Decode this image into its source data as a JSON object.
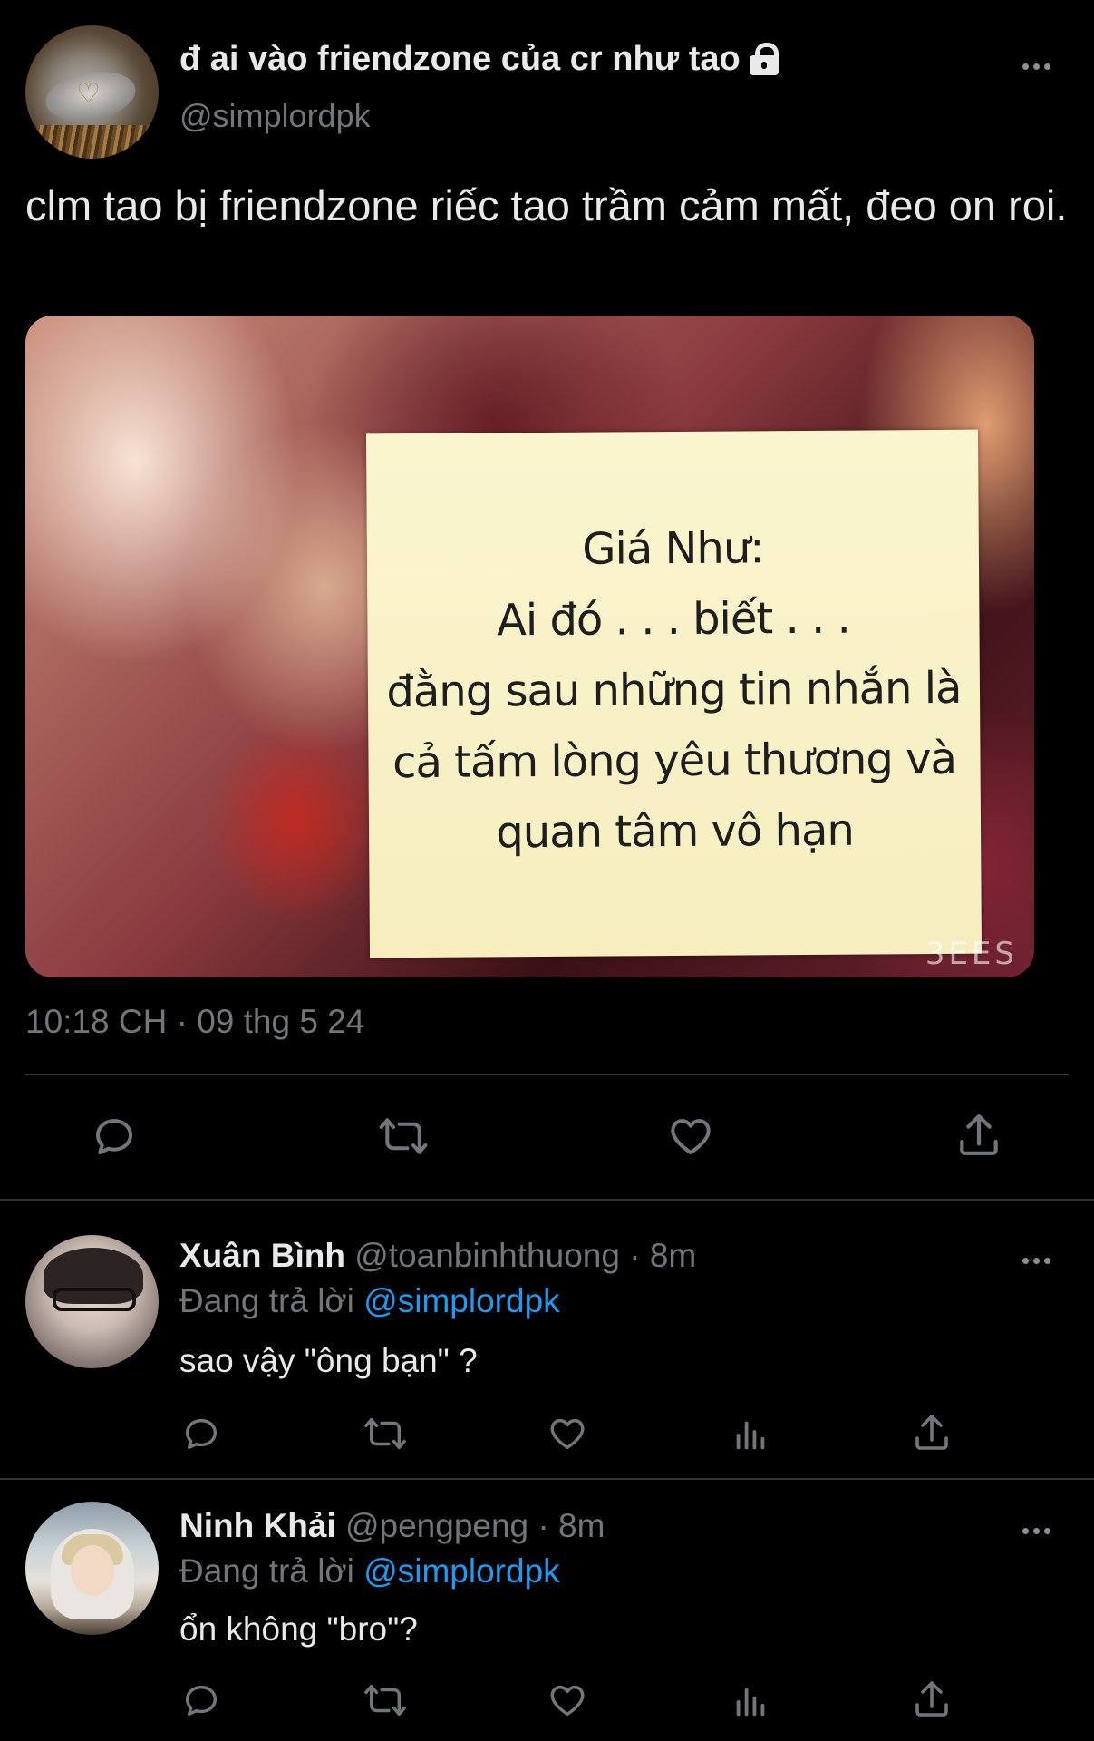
{
  "main_tweet": {
    "display_name": "đ ai vào friendzone của cr như tao",
    "handle": "@simplordpk",
    "text": "clm tao bị friendzone riếc tao trầm cảm mất, đeo on roi.",
    "image": {
      "note_lines": [
        "Giá Như:",
        "Ai đó . . . biết . . .",
        "đằng sau những tin nhắn là",
        "cả tấm lòng yêu thương và",
        "quan tâm vô hạn"
      ],
      "watermark": "3EES"
    },
    "timestamp": "10:18 CH · 09 thg 5 24",
    "actions": [
      "reply-icon",
      "retweet-icon",
      "like-icon",
      "share-icon"
    ]
  },
  "replies": [
    {
      "name": "Xuân Bình",
      "handle": "@toanbinhthuong",
      "separator": "·",
      "time": "8m",
      "replying_prefix": "Đang trả lời",
      "replying_to": "@simplordpk",
      "text": "sao vậy \"ông bạn\" ?"
    },
    {
      "name": "Ninh Khải",
      "handle": "@pengpeng",
      "separator": "·",
      "time": "8m",
      "replying_prefix": "Đang trả lời",
      "replying_to": "@simplordpk",
      "text": "ổn không \"bro\"?"
    }
  ],
  "colors": {
    "background": "#000000",
    "text": "#e7e9ea",
    "secondary": "#71767b",
    "link": "#1d9bf0",
    "divider": "#2f3336"
  }
}
